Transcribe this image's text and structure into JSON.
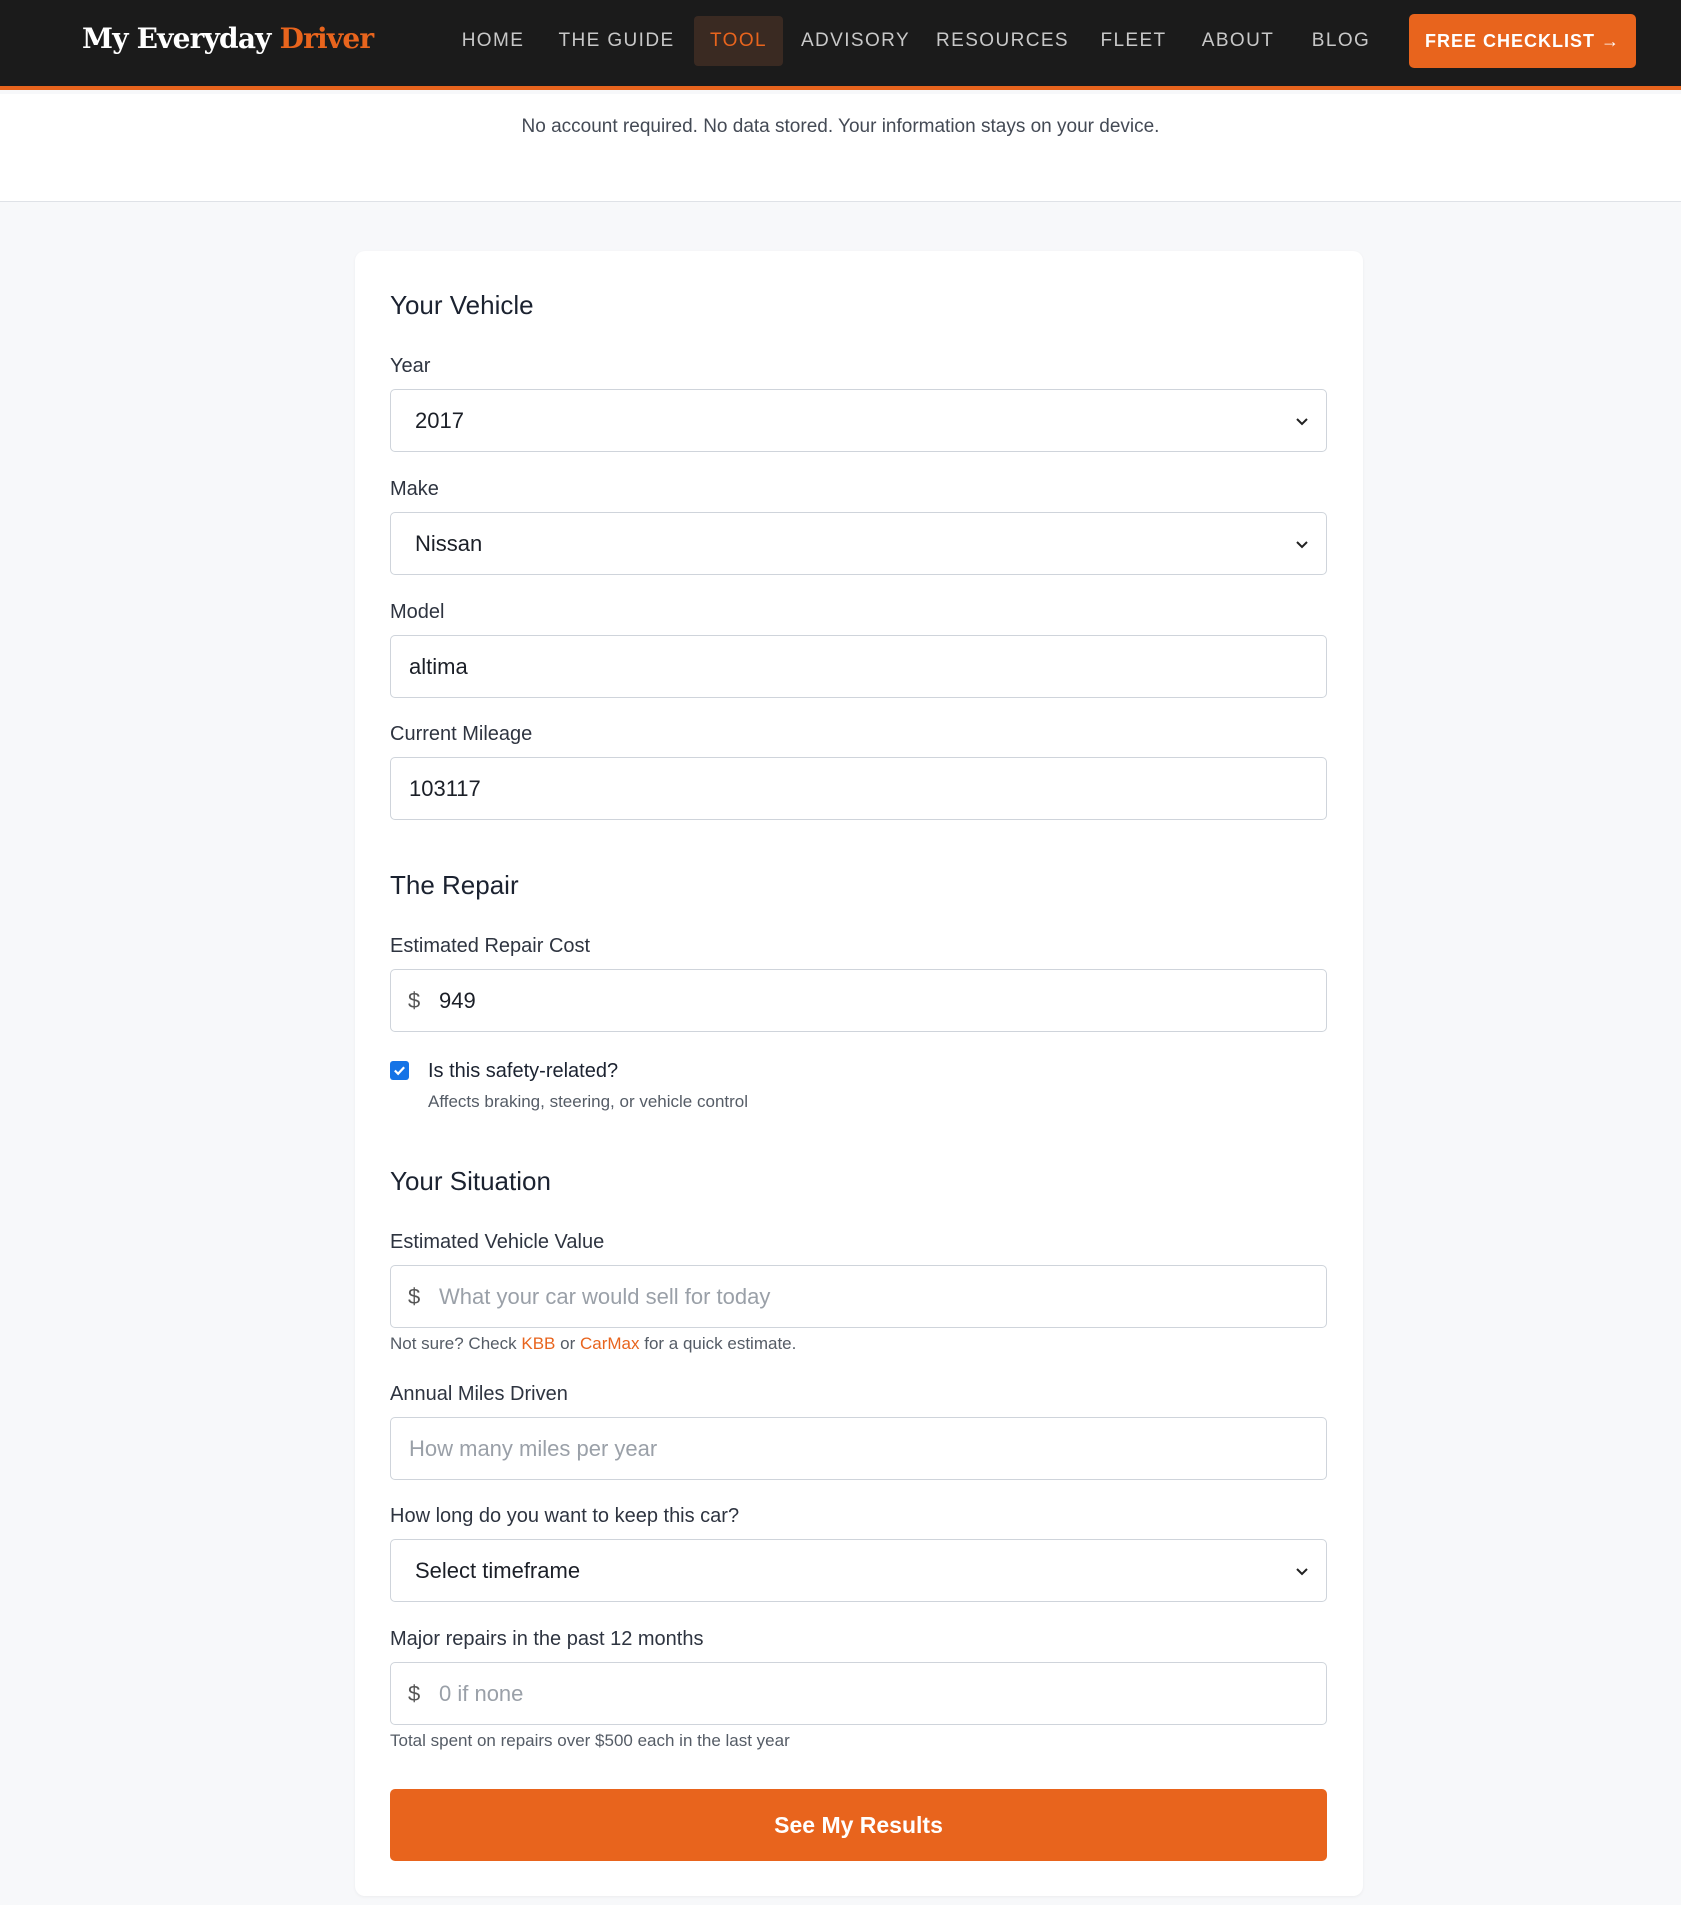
{
  "header": {
    "logo_main": "My Everyday",
    "logo_accent": "Driver",
    "nav": [
      "HOME",
      "THE GUIDE",
      "TOOL",
      "ADVISORY",
      "RESOURCES",
      "FLEET",
      "ABOUT",
      "BLOG"
    ],
    "active_nav": "TOOL",
    "cta_label": "FREE CHECKLIST →"
  },
  "notice": "No account required. No data stored. Your information stays on your device.",
  "vehicle": {
    "title": "Your Vehicle",
    "year_label": "Year",
    "year_value": "2017",
    "make_label": "Make",
    "make_value": "Nissan",
    "model_label": "Model",
    "model_value": "altima",
    "mileage_label": "Current Mileage",
    "mileage_value": "103117"
  },
  "repair": {
    "title": "The Repair",
    "cost_label": "Estimated Repair Cost",
    "cost_prefix": "$",
    "cost_value": "949",
    "safety_label": "Is this safety-related?",
    "safety_sub": "Affects braking, steering, or vehicle control",
    "safety_checked": true
  },
  "situation": {
    "title": "Your Situation",
    "value_label": "Estimated Vehicle Value",
    "value_prefix": "$",
    "value_placeholder": "What your car would sell for today",
    "value_help_pre": "Not sure? Check",
    "value_help_link1": "KBB",
    "value_help_mid": "or",
    "value_help_link2": "CarMax",
    "value_help_post": "for a quick estimate.",
    "miles_label": "Annual Miles Driven",
    "miles_placeholder": "How many miles per year",
    "keep_label": "How long do you want to keep this car?",
    "keep_value": "Select timeframe",
    "past_label": "Major repairs in the past 12 months",
    "past_prefix": "$",
    "past_placeholder": "0 if none",
    "past_help": "Total spent on repairs over $500 each in the last year"
  },
  "submit_label": "See My Results",
  "colors": {
    "accent": "#e8641d",
    "header_bg": "#1b1b1b",
    "checkbox": "#1473e6"
  }
}
